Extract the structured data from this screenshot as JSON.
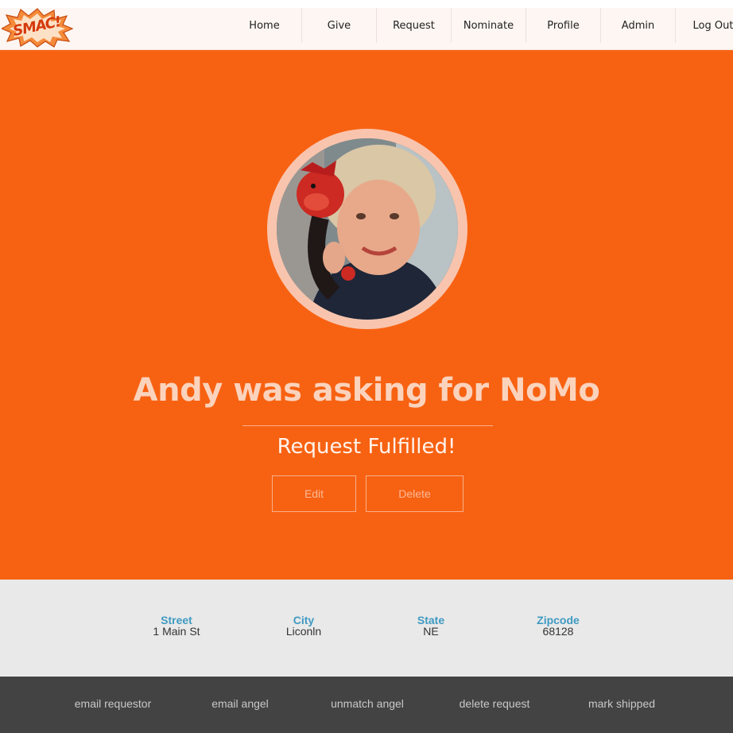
{
  "brand": {
    "logo_text": "SMAC!"
  },
  "nav": {
    "items": [
      {
        "label": "Home"
      },
      {
        "label": "Give"
      },
      {
        "label": "Request"
      },
      {
        "label": "Nominate"
      },
      {
        "label": "Profile"
      },
      {
        "label": "Admin"
      },
      {
        "label": "Log Out"
      }
    ]
  },
  "hero": {
    "title": "Andy was asking for NoMo",
    "status": "Request Fulfilled!",
    "edit_label": "Edit",
    "delete_label": "Delete"
  },
  "address": {
    "street_label": "Street",
    "street_value": "1 Main St",
    "city_label": "City",
    "city_value": "Liconln",
    "state_label": "State",
    "state_value": "NE",
    "zip_label": "Zipcode",
    "zip_value": "68128"
  },
  "footer": {
    "links": [
      {
        "label": "email requestor"
      },
      {
        "label": "email angel"
      },
      {
        "label": "unmatch angel"
      },
      {
        "label": "delete request"
      },
      {
        "label": "mark shipped"
      }
    ]
  },
  "colors": {
    "accent": "#f76212",
    "nav_bg": "#fdf6f2",
    "address_bg": "#e9e9e9",
    "footer_bg": "#434343",
    "label_blue": "#3e9ac2"
  }
}
